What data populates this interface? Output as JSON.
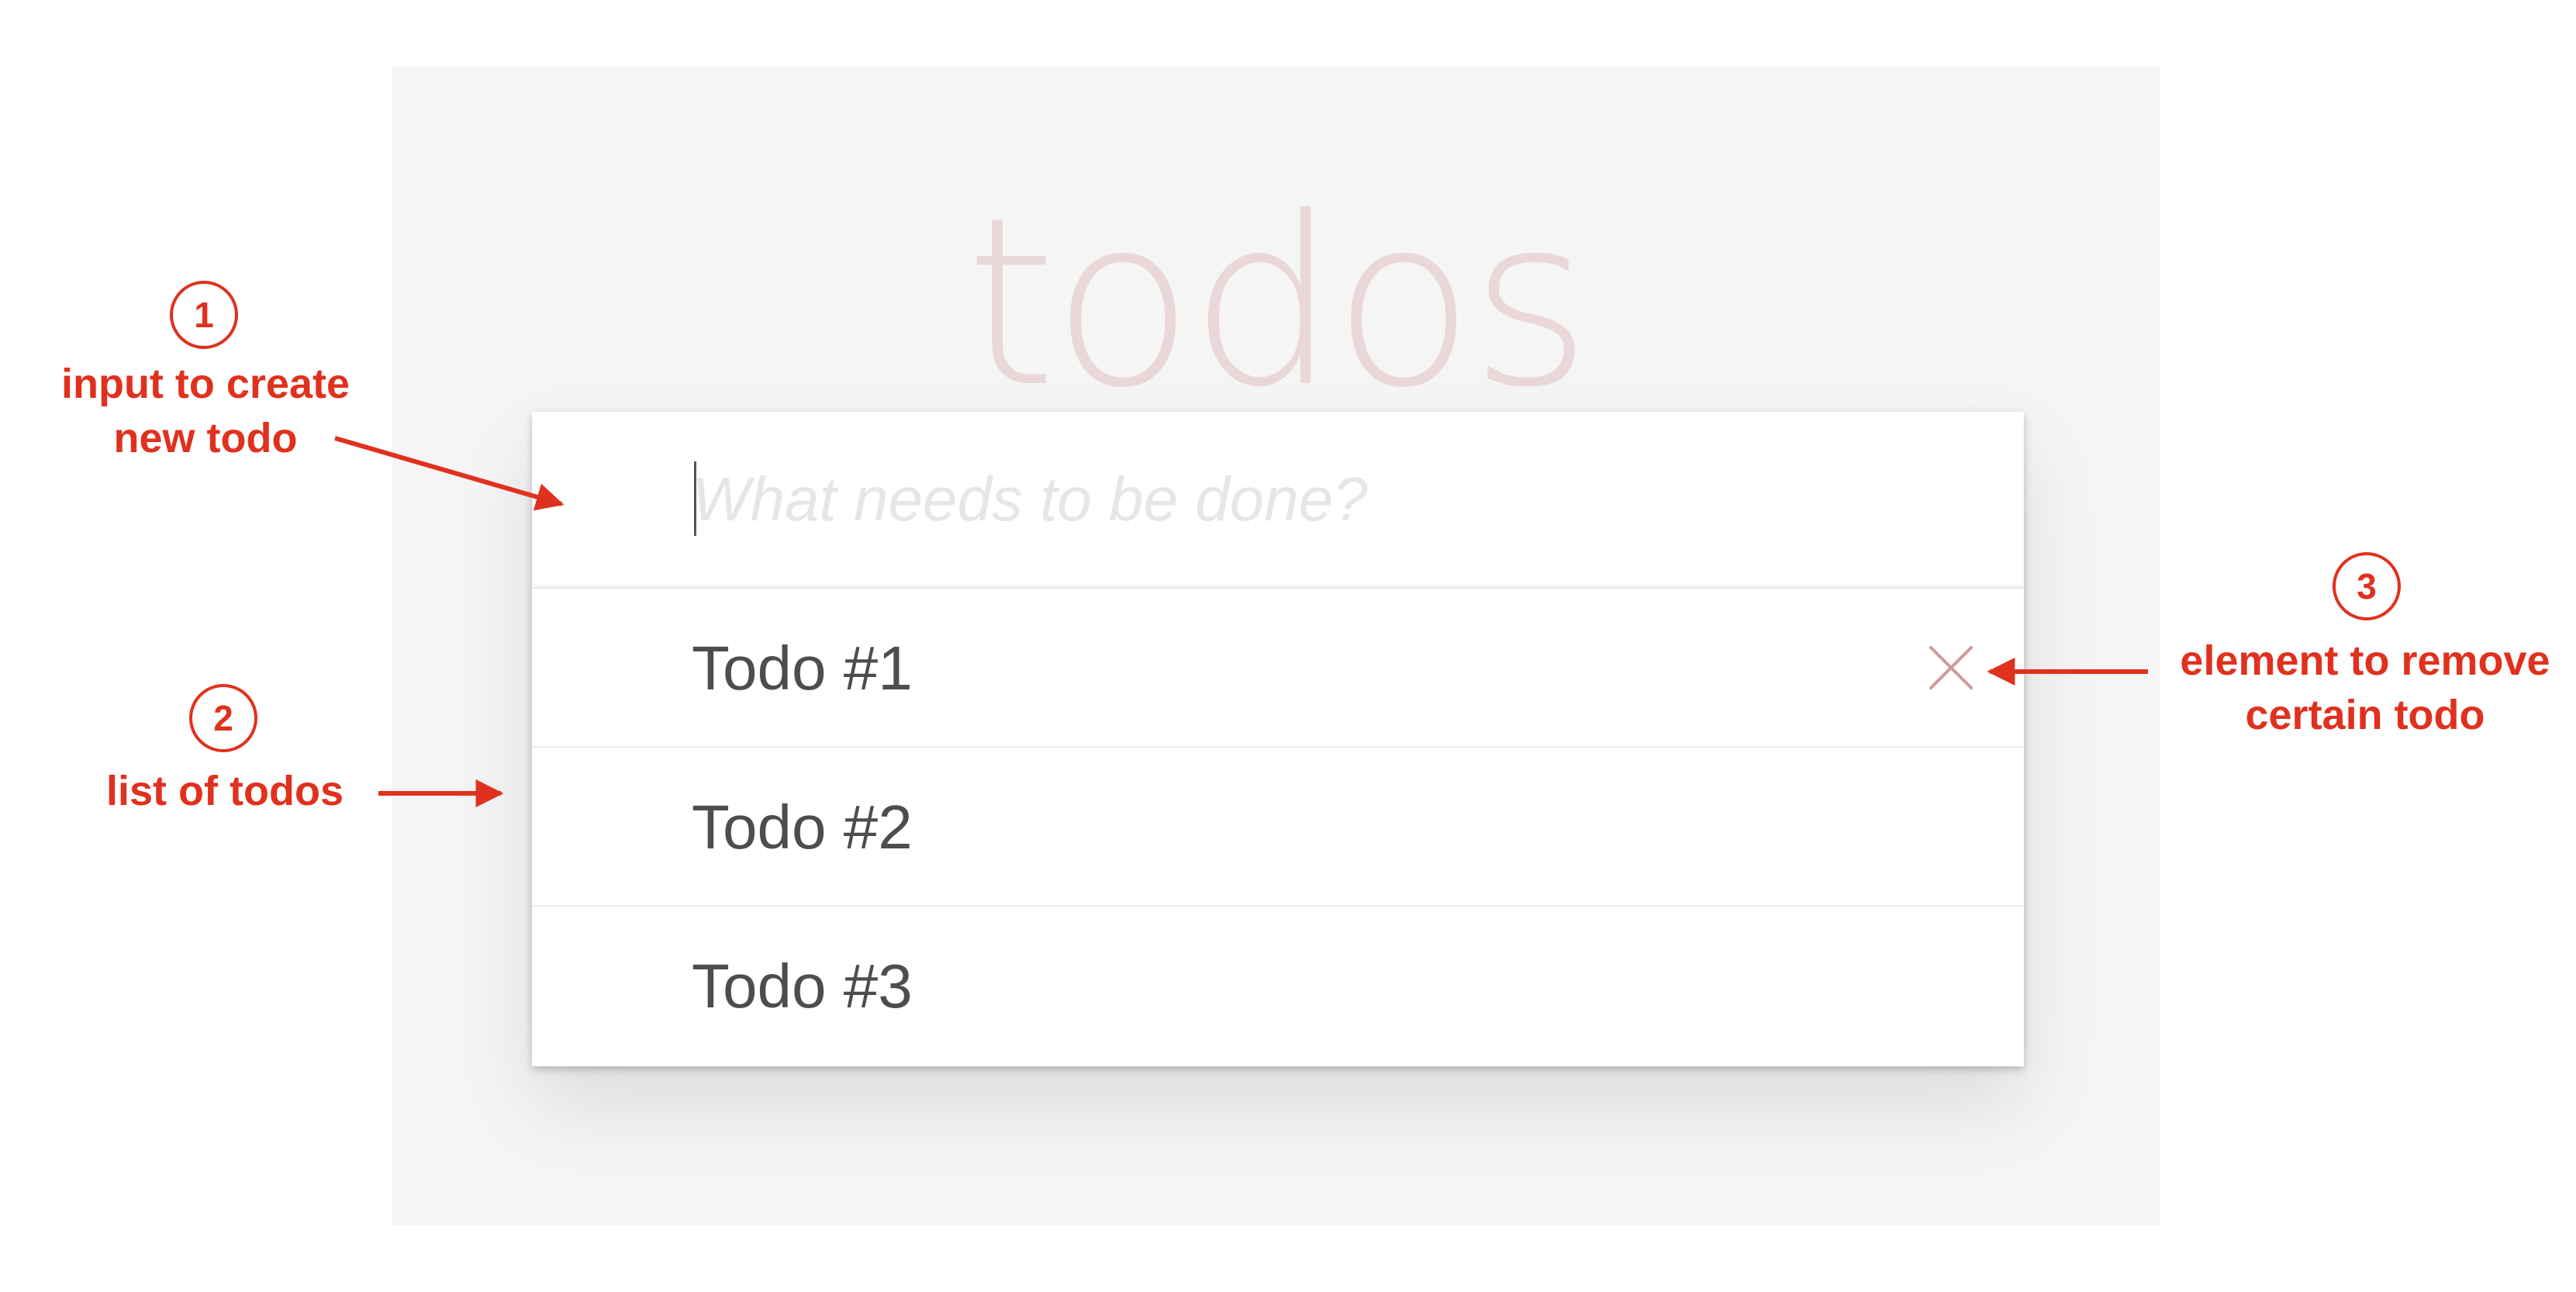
{
  "app": {
    "title": "todos",
    "new_todo_placeholder": "What needs to be done?"
  },
  "todos": [
    {
      "label": "Todo #1"
    },
    {
      "label": "Todo #2"
    },
    {
      "label": "Todo #3"
    }
  ],
  "icons": {
    "destroy": "close-icon"
  },
  "annotations": [
    {
      "number": "1",
      "line1": "input to create",
      "line2": "new todo"
    },
    {
      "number": "2",
      "line1": "list of todos"
    },
    {
      "number": "3",
      "line1": "element to remove",
      "line2": "certain todo"
    }
  ],
  "colors": {
    "annotation": "#e0311e",
    "title": "#af2f2f",
    "destroy_icon": "#cc9a9a",
    "app_background": "#f5f5f5"
  }
}
